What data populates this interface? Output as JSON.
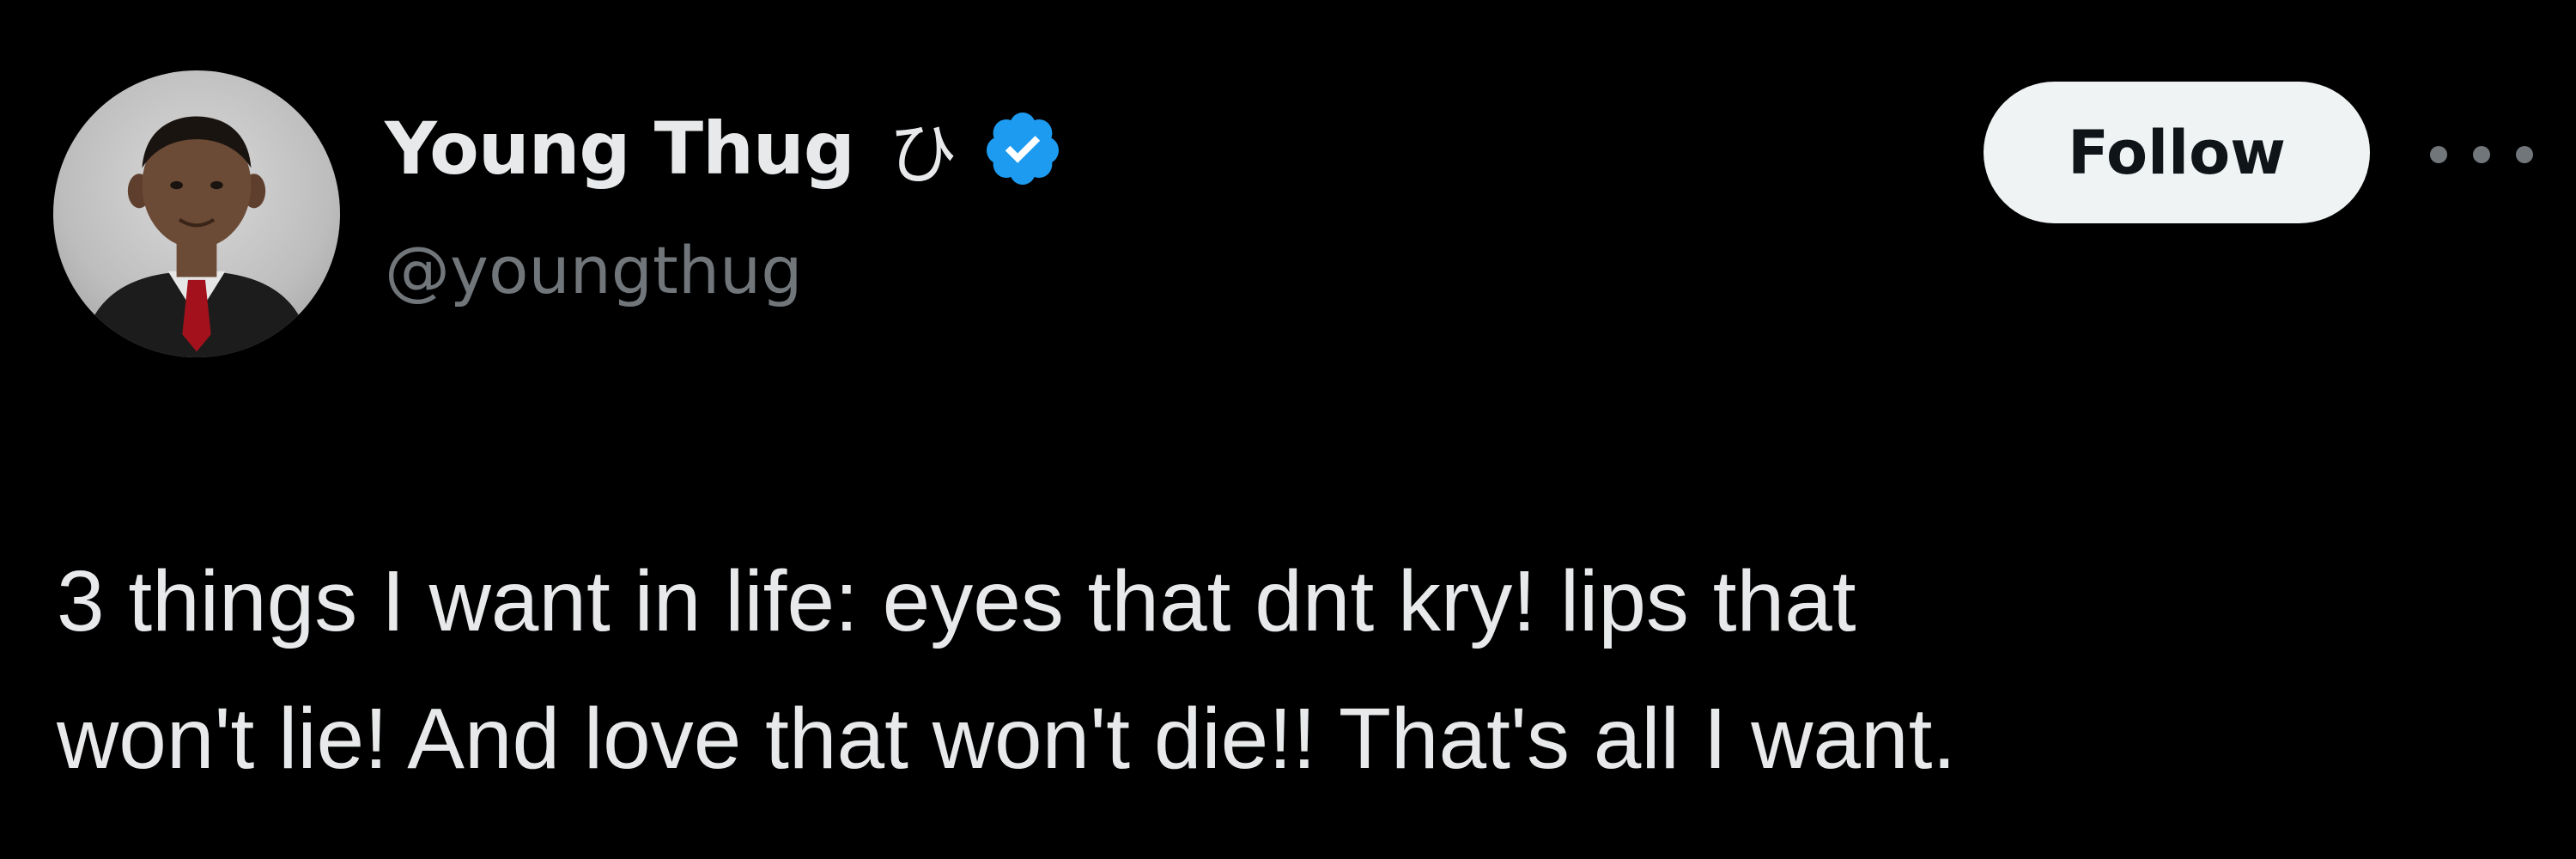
{
  "author": {
    "display_name": "Young Thug",
    "name_glyph": "ひ",
    "handle": "@youngthug",
    "verified": true,
    "verified_color": "#1d9bf0"
  },
  "actions": {
    "follow_label": "Follow",
    "more_icon": "more-horizontal-icon"
  },
  "tweet": {
    "lines": [
      "3 things I want in life: eyes that dnt kry! lips that",
      "won't lie! And love that won't die!! That's all I want."
    ]
  },
  "colors": {
    "background": "#000000",
    "primary_text": "#e7e9ea",
    "secondary_text": "#71767b",
    "follow_button_bg": "#eff3f4",
    "follow_button_text": "#0f1419"
  }
}
